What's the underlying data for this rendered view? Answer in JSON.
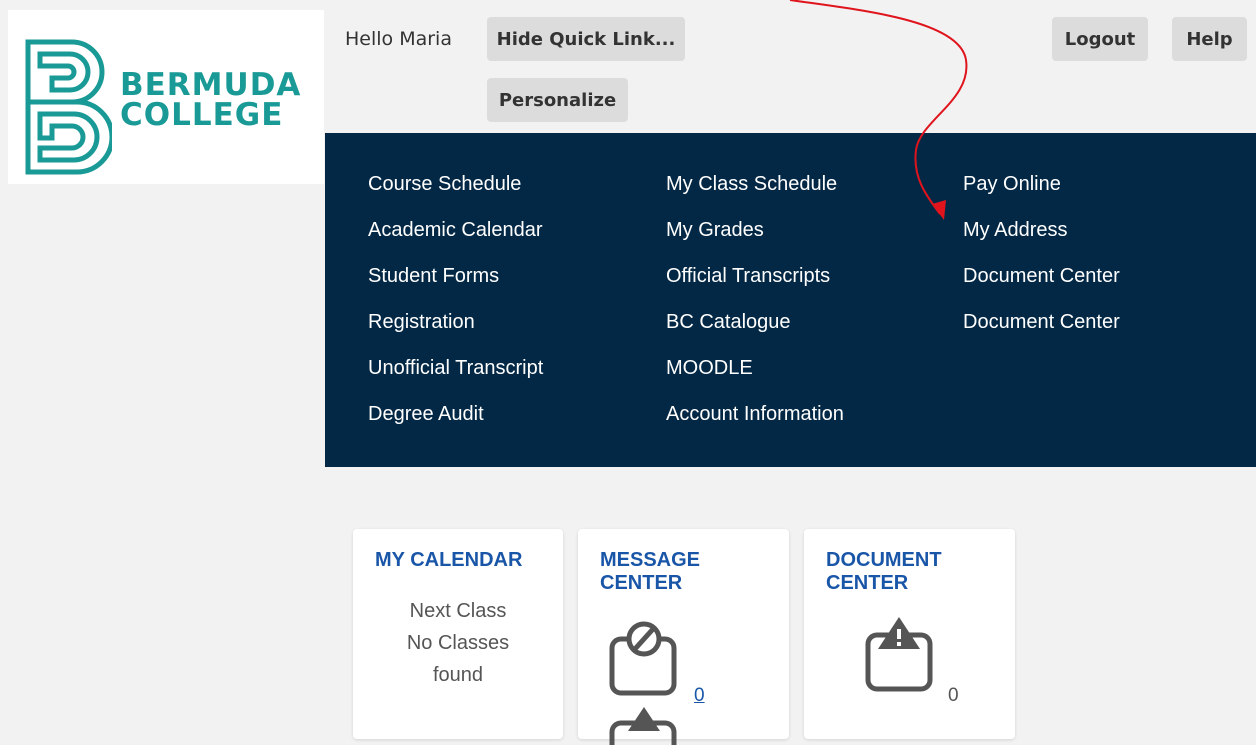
{
  "brand": {
    "line1": "BERMUDA",
    "line2": "COLLEGE",
    "color": "#1a9a96"
  },
  "header": {
    "greeting": "Hello Maria",
    "hide_quick_links": "Hide Quick Link...",
    "personalize": "Personalize",
    "logout": "Logout",
    "help": "Help"
  },
  "quick_links": {
    "column1": [
      "Course Schedule",
      "Academic Calendar",
      "Student Forms",
      "Registration",
      "Unofficial Transcript",
      "Degree Audit"
    ],
    "column2": [
      "My Class Schedule",
      "My Grades",
      "Official Transcripts",
      "BC Catalogue",
      "MOODLE",
      "Account Information"
    ],
    "column3": [
      "Pay Online",
      "My Address",
      "Document Center",
      "Document Center"
    ]
  },
  "cards": {
    "calendar": {
      "title": "MY CALENDAR",
      "line1": "Next Class",
      "line2": "No Classes",
      "line3": "found"
    },
    "messages": {
      "title": "MESSAGE CENTER",
      "count": "0",
      "icon": "clipboard-blocked-icon"
    },
    "documents": {
      "title": "DOCUMENT CENTER",
      "count": "0",
      "icon": "clipboard-warning-icon"
    }
  },
  "colors": {
    "nav_bg": "#032845",
    "link_blue": "#1a56a8",
    "annotation_arrow": "#e0141c"
  }
}
